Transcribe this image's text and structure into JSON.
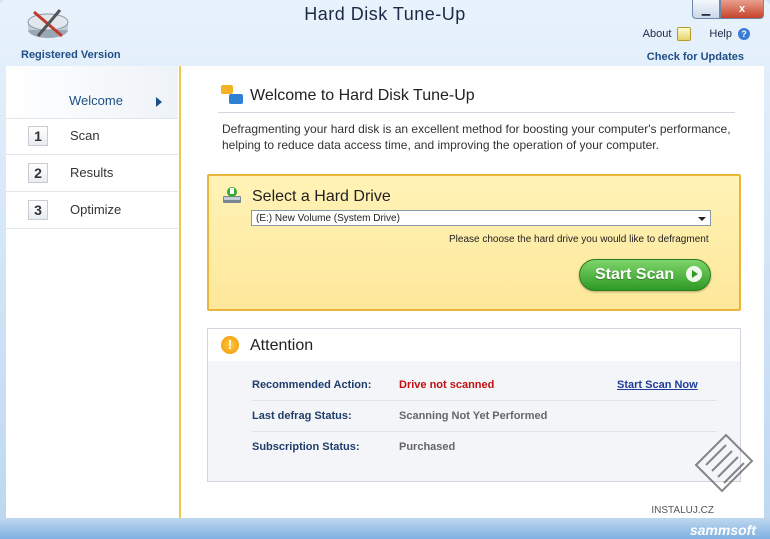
{
  "window": {
    "title": "Hard Disk Tune-Up",
    "buttons": {
      "min": "▭",
      "max": "",
      "close": "x"
    }
  },
  "topright": {
    "about": "About",
    "help": "Help"
  },
  "subheader": {
    "registered": "Registered Version",
    "check_updates": "Check for Updates"
  },
  "sidebar": {
    "items": [
      {
        "num": "",
        "label": "Welcome",
        "active": true
      },
      {
        "num": "1",
        "label": "Scan"
      },
      {
        "num": "2",
        "label": "Results"
      },
      {
        "num": "3",
        "label": "Optimize"
      }
    ]
  },
  "main": {
    "welcome_title": "Welcome to Hard Disk Tune-Up",
    "description": "Defragmenting your hard disk is an excellent method for boosting your computer's performance, helping to reduce data access time, and improving the operation of your computer.",
    "select": {
      "title": "Select a Hard Drive",
      "selected": "(E:) New Volume (System Drive)",
      "hint": "Please choose the hard drive you would like to defragment",
      "button": "Start Scan"
    },
    "attention": {
      "title": "Attention",
      "rows": [
        {
          "key": "Recommended Action:",
          "value": "Drive not scanned",
          "link": "Start Scan Now"
        },
        {
          "key": "Last defrag Status:",
          "value": "Scanning Not Yet Performed"
        },
        {
          "key": "Subscription Status:",
          "value": "Purchased"
        }
      ]
    }
  },
  "footer": {
    "brand": "sammsoft",
    "watermark": "INSTALUJ.CZ"
  }
}
